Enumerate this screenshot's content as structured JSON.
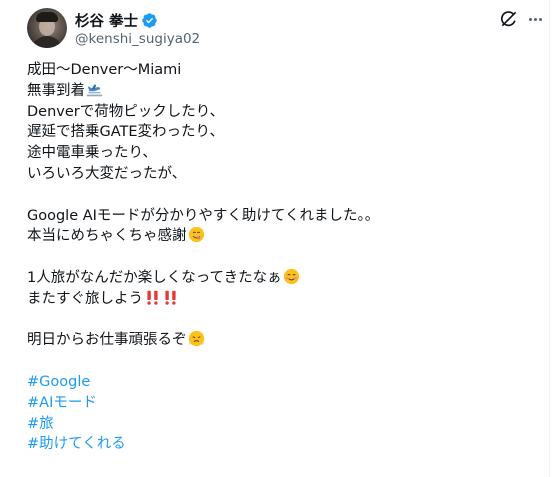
{
  "author": {
    "display_name": "杉谷 拳士",
    "handle": "@kenshi_sugiya02"
  },
  "tweet": {
    "lines": [
      "成田〜Denver〜Miami",
      "無事到着",
      "Denverで荷物ピックしたり、",
      "遅延で搭乗GATE変わったり、",
      "途中電車乗ったり、",
      "いろいろ大変だったが、",
      "",
      "Google AIモードが分かりやすく助けてくれました。。",
      "本当にめちゃくちゃ感謝",
      "",
      "1人旅がなんだか楽しくなってきたなぁ",
      "またすぐ旅しよう",
      "",
      "明日からお仕事頑張るぞ",
      ""
    ],
    "hashtags": [
      "#Google",
      "#AIモード",
      "#旅",
      "#助けてくれる"
    ]
  },
  "icons": {
    "verified": "verified-badge-icon",
    "grok": "grok-icon",
    "more": "more-icon"
  },
  "colors": {
    "link": "#1d9bf0",
    "verified": "#1d9bf0",
    "secondary_text": "#536471"
  }
}
